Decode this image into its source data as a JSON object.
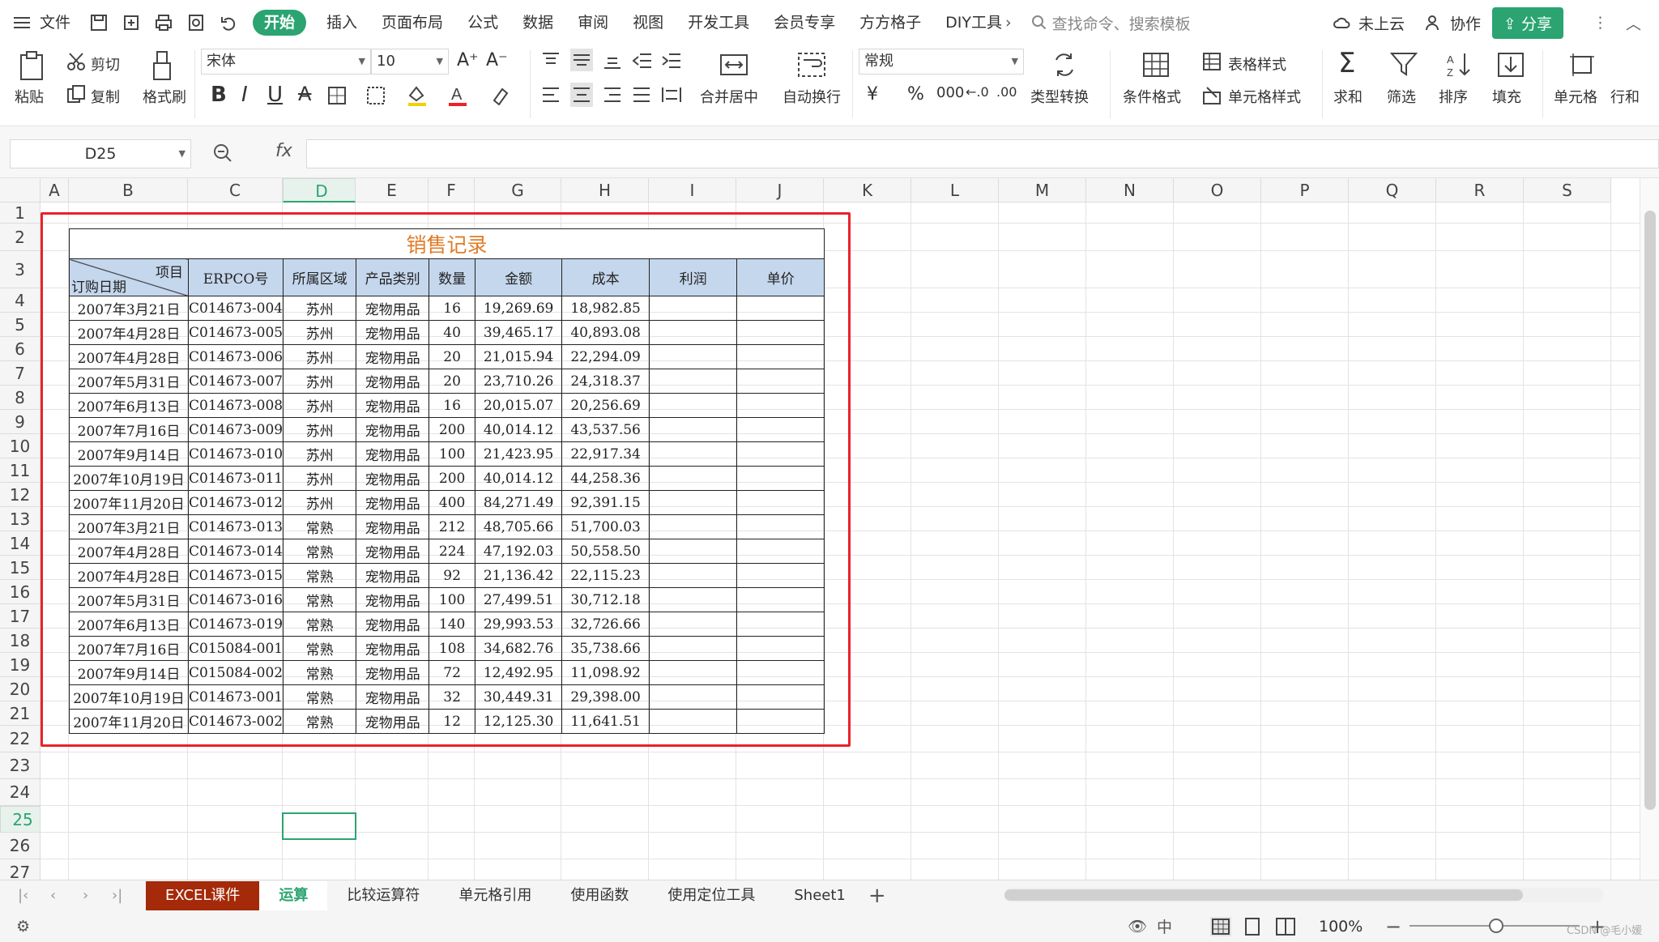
{
  "menubar": {
    "file_label": "文件",
    "tabs": [
      "开始",
      "插入",
      "页面布局",
      "公式",
      "数据",
      "审阅",
      "视图",
      "开发工具",
      "会员专享",
      "方方格子",
      "DIY工具"
    ],
    "more_arrow": "›",
    "search_placeholder": "查找命令、搜索模板",
    "cloud_label": "未上云",
    "collab_label": "协作",
    "share_label": "分享"
  },
  "ribbon": {
    "paste": "粘贴",
    "cut": "剪切",
    "copy": "复制",
    "format_painter": "格式刷",
    "font_name": "宋体",
    "font_size": "10",
    "merge_center": "合并居中",
    "wrap_text": "自动换行",
    "number_format": "常规",
    "type_convert": "类型转换",
    "cond_format": "条件格式",
    "table_style": "表格样式",
    "cell_style": "单元格样式",
    "sum": "求和",
    "filter": "筛选",
    "sort": "排序",
    "fill": "填充",
    "cell": "单元格",
    "row_col": "行和",
    "currency_symbol": "¥",
    "percent_symbol": "%",
    "thousands_symbol": "000"
  },
  "formula_bar": {
    "name_box": "D25",
    "fx": "fx",
    "formula": ""
  },
  "columns": [
    "A",
    "B",
    "C",
    "D",
    "E",
    "F",
    "G",
    "H",
    "I",
    "J",
    "K",
    "L",
    "M",
    "N",
    "O",
    "P",
    "Q",
    "R",
    "S"
  ],
  "selected_column": "D",
  "rows": [
    "1",
    "2",
    "3",
    "4",
    "5",
    "6",
    "7",
    "8",
    "9",
    "10",
    "11",
    "12",
    "13",
    "14",
    "15",
    "16",
    "17",
    "18",
    "19",
    "20",
    "21",
    "22",
    "23",
    "24",
    "25",
    "26",
    "27"
  ],
  "selected_row": "25",
  "table": {
    "title": "销售记录",
    "diag_top": "项目",
    "diag_bottom": "订购日期",
    "headers": [
      "ERPCO号",
      "所属区域",
      "产品类别",
      "数量",
      "金额",
      "成本",
      "利润",
      "单价"
    ],
    "rows": [
      [
        "2007年3月21日",
        "C014673-004",
        "苏州",
        "宠物用品",
        "16",
        "19,269.69",
        "18,982.85",
        "",
        ""
      ],
      [
        "2007年4月28日",
        "C014673-005",
        "苏州",
        "宠物用品",
        "40",
        "39,465.17",
        "40,893.08",
        "",
        ""
      ],
      [
        "2007年4月28日",
        "C014673-006",
        "苏州",
        "宠物用品",
        "20",
        "21,015.94",
        "22,294.09",
        "",
        ""
      ],
      [
        "2007年5月31日",
        "C014673-007",
        "苏州",
        "宠物用品",
        "20",
        "23,710.26",
        "24,318.37",
        "",
        ""
      ],
      [
        "2007年6月13日",
        "C014673-008",
        "苏州",
        "宠物用品",
        "16",
        "20,015.07",
        "20,256.69",
        "",
        ""
      ],
      [
        "2007年7月16日",
        "C014673-009",
        "苏州",
        "宠物用品",
        "200",
        "40,014.12",
        "43,537.56",
        "",
        ""
      ],
      [
        "2007年9月14日",
        "C014673-010",
        "苏州",
        "宠物用品",
        "100",
        "21,423.95",
        "22,917.34",
        "",
        ""
      ],
      [
        "2007年10月19日",
        "C014673-011",
        "苏州",
        "宠物用品",
        "200",
        "40,014.12",
        "44,258.36",
        "",
        ""
      ],
      [
        "2007年11月20日",
        "C014673-012",
        "苏州",
        "宠物用品",
        "400",
        "84,271.49",
        "92,391.15",
        "",
        ""
      ],
      [
        "2007年3月21日",
        "C014673-013",
        "常熟",
        "宠物用品",
        "212",
        "48,705.66",
        "51,700.03",
        "",
        ""
      ],
      [
        "2007年4月28日",
        "C014673-014",
        "常熟",
        "宠物用品",
        "224",
        "47,192.03",
        "50,558.50",
        "",
        ""
      ],
      [
        "2007年4月28日",
        "C014673-015",
        "常熟",
        "宠物用品",
        "92",
        "21,136.42",
        "22,115.23",
        "",
        ""
      ],
      [
        "2007年5月31日",
        "C014673-016",
        "常熟",
        "宠物用品",
        "100",
        "27,499.51",
        "30,712.18",
        "",
        ""
      ],
      [
        "2007年6月13日",
        "C014673-019",
        "常熟",
        "宠物用品",
        "140",
        "29,993.53",
        "32,726.66",
        "",
        ""
      ],
      [
        "2007年7月16日",
        "C015084-001",
        "常熟",
        "宠物用品",
        "108",
        "34,682.76",
        "35,738.66",
        "",
        ""
      ],
      [
        "2007年9月14日",
        "C015084-002",
        "常熟",
        "宠物用品",
        "72",
        "12,492.95",
        "11,098.92",
        "",
        ""
      ],
      [
        "2007年10月19日",
        "C014673-001",
        "常熟",
        "宠物用品",
        "32",
        "30,449.31",
        "29,398.00",
        "",
        ""
      ],
      [
        "2007年11月20日",
        "C014673-002",
        "常熟",
        "宠物用品",
        "12",
        "12,125.30",
        "11,641.51",
        "",
        ""
      ]
    ]
  },
  "sheet_tabs": [
    "EXCEL课件",
    "运算",
    "比较运算符",
    "单元格引用",
    "使用函数",
    "使用定位工具",
    "Sheet1"
  ],
  "active_sheet": "运算",
  "add_sheet": "+",
  "status": {
    "zoom": "100%",
    "watermark": "CSDN @毛小媛"
  },
  "colors": {
    "accent": "#2ba471",
    "header_fill": "#c5d7ed",
    "title": "#e07b28",
    "highlight_box": "#e8232a",
    "excel_tab": "#a52a0a"
  },
  "icons": [
    "menu-icon",
    "save-icon",
    "print-icon",
    "undo-icon",
    "search-icon",
    "cloud-icon",
    "collab-icon",
    "share-icon",
    "bold-icon",
    "italic-icon",
    "underline-icon",
    "zoom-icon",
    "eye-icon",
    "grid-view-icon"
  ]
}
